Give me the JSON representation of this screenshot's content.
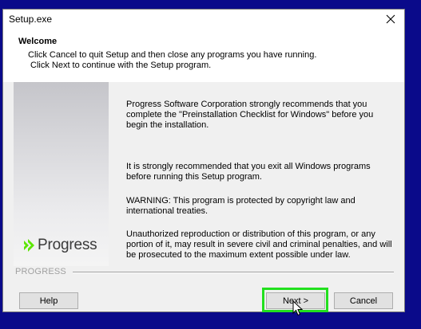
{
  "window": {
    "title": "Setup.exe"
  },
  "header": {
    "title": "Welcome",
    "line1": "Click Cancel to quit Setup and then close any programs you have running.",
    "line2": "Click Next to continue with the Setup program."
  },
  "sidebar": {
    "logo_text": "Progress",
    "logo_icon": "progress-chevrons-icon",
    "brand_color": "#5ce500"
  },
  "content": {
    "paragraphs": [
      "Progress Software Corporation strongly recommends that you complete the \"Preinstallation Checklist for Windows\" before you begin the installation.",
      "It is strongly recommended that you exit all Windows programs before running this Setup program.",
      "WARNING: This program is protected by copyright law and international treaties.",
      "Unauthorized reproduction or distribution of this program, or any portion of it, may result in severe civil and criminal penalties, and will be prosecuted to the maximum extent possible under law."
    ]
  },
  "footer": {
    "section_label": "PROGRESS",
    "help_label": "Help",
    "next_label": "Next >",
    "cancel_label": "Cancel",
    "highlight_color": "#22e01e"
  }
}
